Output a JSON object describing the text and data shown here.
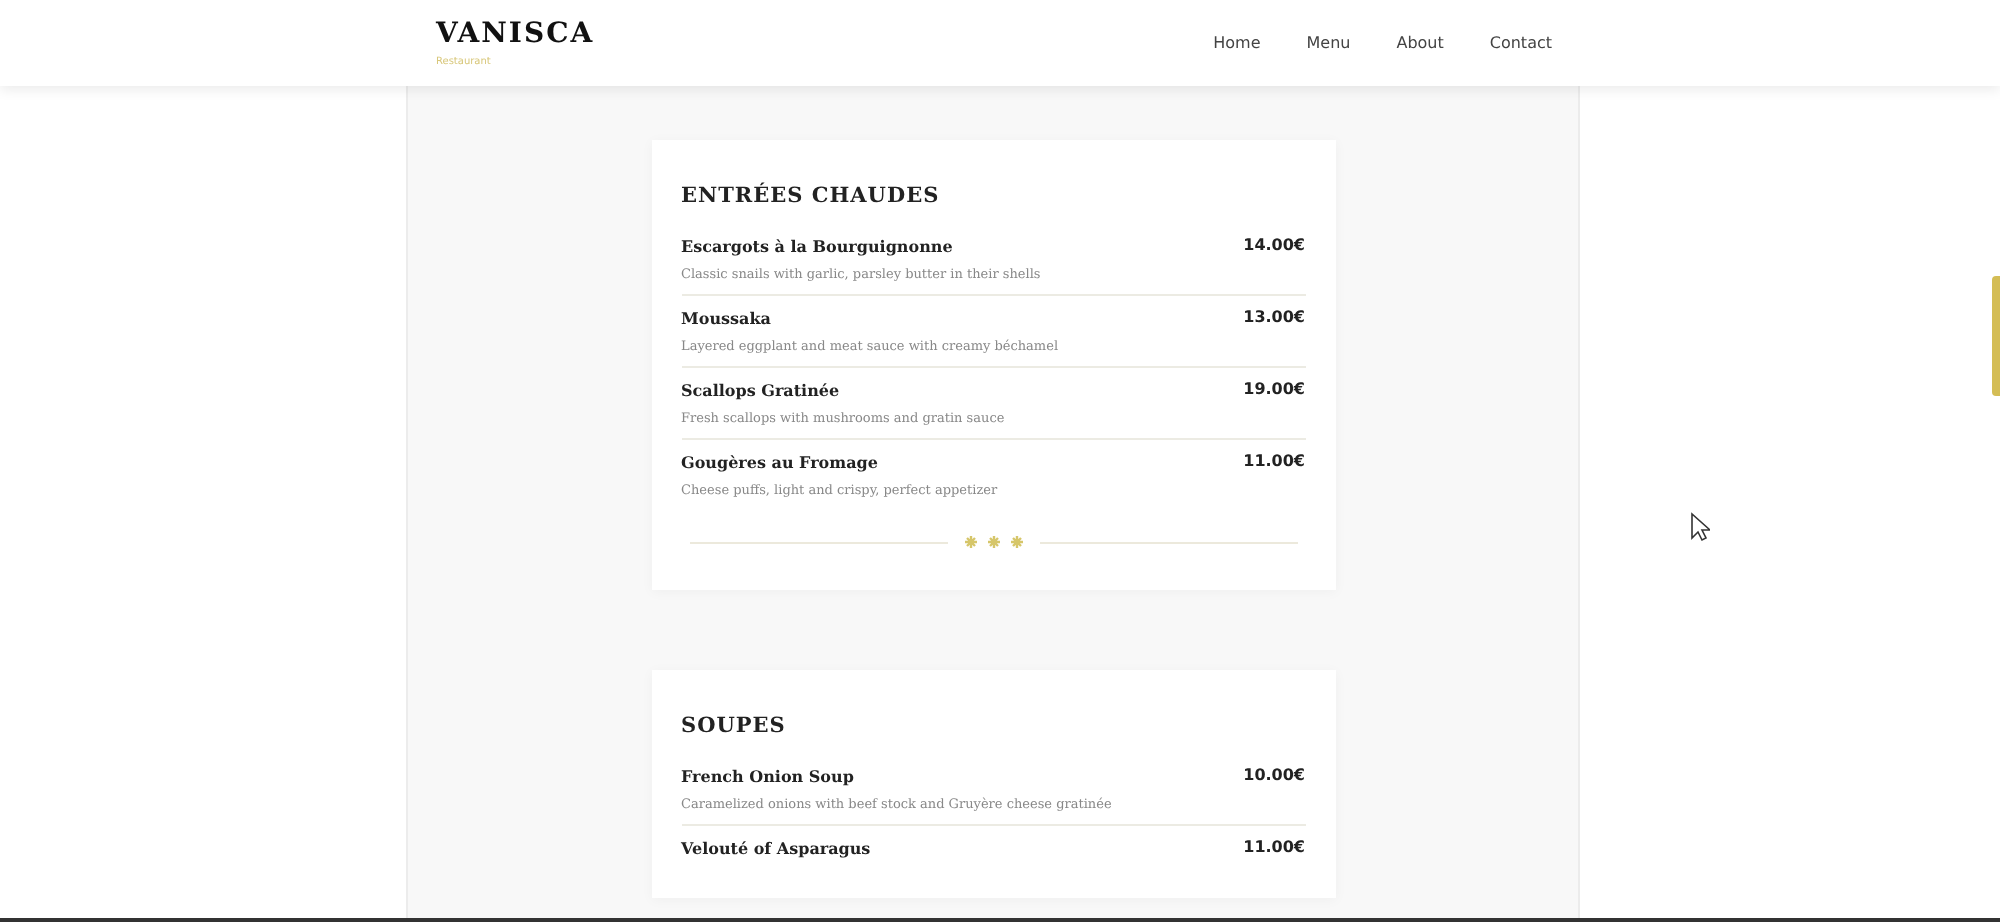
{
  "header": {
    "brand": "VANISCA",
    "tagline": "Restaurant",
    "nav": [
      {
        "label": "Home"
      },
      {
        "label": "Menu"
      },
      {
        "label": "About"
      },
      {
        "label": "Contact"
      }
    ]
  },
  "sections": [
    {
      "title": "ENTRÉES CHAUDES",
      "ornament": true,
      "items": [
        {
          "name": "Escargots à la Bourguignonne",
          "price": "14.00€",
          "description": "Classic snails with garlic, parsley butter in their shells"
        },
        {
          "name": "Moussaka",
          "price": "13.00€",
          "description": "Layered eggplant and meat sauce with creamy béchamel"
        },
        {
          "name": "Scallops Gratinée",
          "price": "19.00€",
          "description": "Fresh scallops with mushrooms and gratin sauce"
        },
        {
          "name": "Gougères au Fromage",
          "price": "11.00€",
          "description": "Cheese puffs, light and crispy, perfect appetizer"
        }
      ]
    },
    {
      "title": "SOUPES",
      "ornament": false,
      "items": [
        {
          "name": "French Onion Soup",
          "price": "10.00€",
          "description": "Caramelized onions with beef stock and Gruyère cheese gratinée"
        },
        {
          "name": "Velouté of Asparagus",
          "price": "11.00€"
        }
      ]
    }
  ]
}
